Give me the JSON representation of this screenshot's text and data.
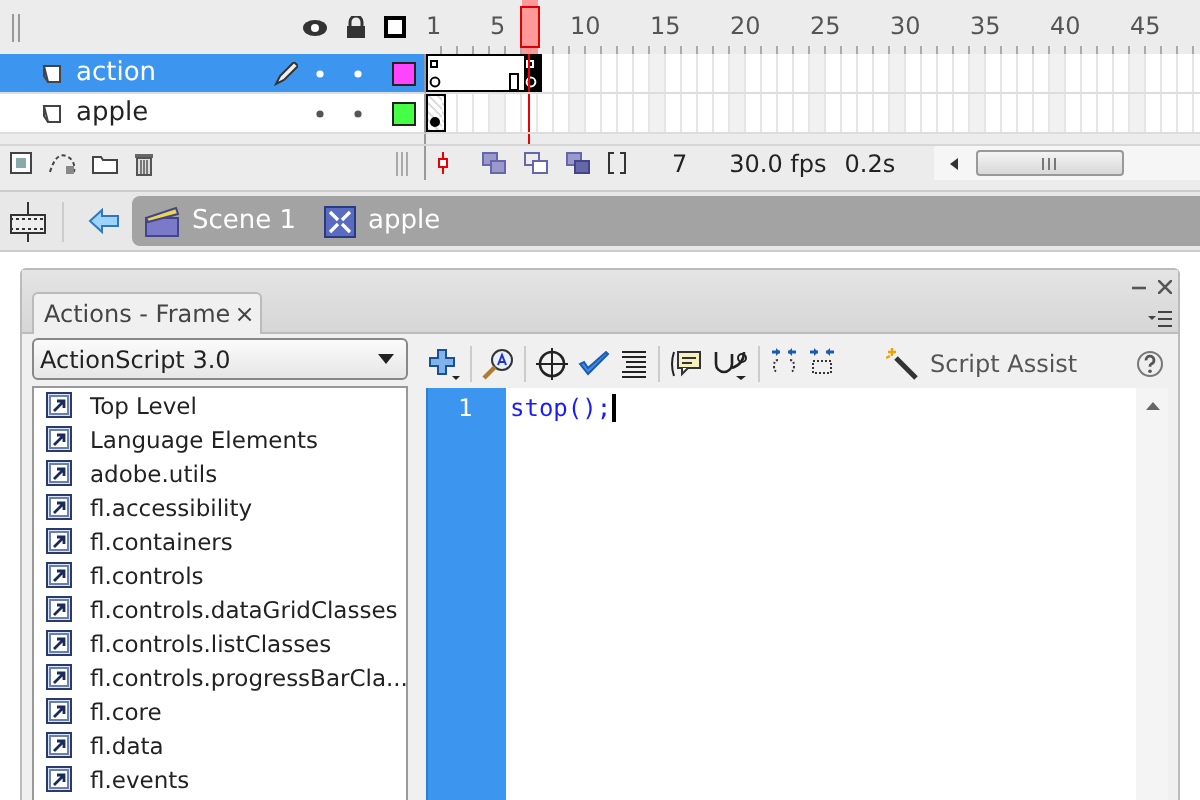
{
  "timeline": {
    "ruler": [
      "1",
      "5",
      "10",
      "15",
      "20",
      "25",
      "30",
      "35",
      "40",
      "45"
    ],
    "layers": [
      {
        "name": "action",
        "selected": true,
        "color": "#ff44ff",
        "frames": [
          {
            "kind": "blank-script"
          },
          {
            "kind": "empty"
          },
          {
            "kind": "empty"
          },
          {
            "kind": "empty"
          },
          {
            "kind": "empty"
          },
          {
            "kind": "end"
          },
          {
            "kind": "key-script"
          }
        ]
      },
      {
        "name": "apple",
        "selected": false,
        "color": "#44ff44",
        "frames": [
          {
            "kind": "key"
          }
        ]
      }
    ],
    "status": {
      "current_frame": "7",
      "frame_rate": "30.0 fps",
      "elapsed": "0.2s"
    }
  },
  "breadcrumb": [
    {
      "label": "Scene 1",
      "kind": "scene"
    },
    {
      "label": "apple",
      "kind": "symbol"
    }
  ],
  "actions_panel": {
    "tab": "Actions - Frame",
    "tab_close": "×",
    "language": "ActionScript 3.0",
    "toolbox": [
      "Top Level",
      "Language Elements",
      "adobe.utils",
      "fl.accessibility",
      "fl.containers",
      "fl.controls",
      "fl.controls.dataGridClasses",
      "fl.controls.listClasses",
      "fl.controls.progressBarCla...",
      "fl.core",
      "fl.data",
      "fl.events"
    ],
    "script_assist": "Script Assist",
    "code_lines": [
      {
        "number": "1",
        "text": "stop();"
      }
    ]
  }
}
